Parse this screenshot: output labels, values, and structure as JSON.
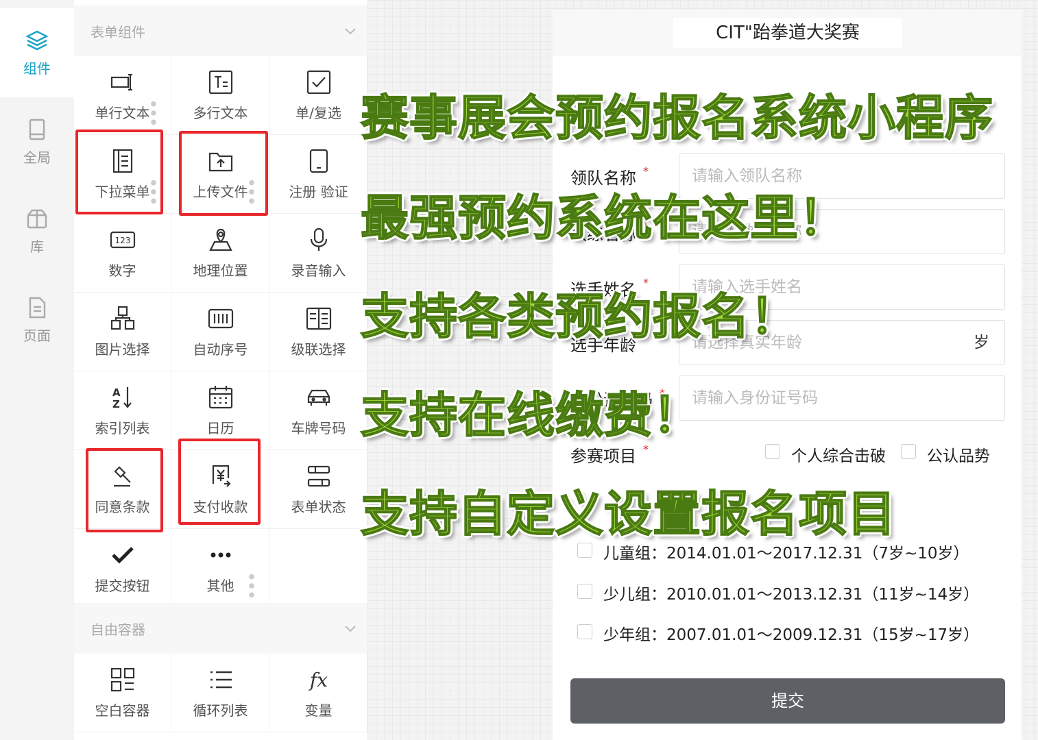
{
  "nav": [
    {
      "label": "组件",
      "icon": "layers-icon",
      "active": true
    },
    {
      "label": "全局",
      "icon": "tablet-icon"
    },
    {
      "label": "库",
      "icon": "box-icon"
    },
    {
      "label": "页面",
      "icon": "document-icon"
    }
  ],
  "sections": {
    "form_components": "表单组件",
    "free_containers": "自由容器"
  },
  "components": {
    "single_text": "单行文本",
    "multi_text": "多行文本",
    "checkbox": "单/复选",
    "dropdown": "下拉菜单",
    "upload": "上传文件",
    "register": "注册 验证",
    "number": "数字",
    "location": "地理位置",
    "audio": "录音输入",
    "image_select": "图片选择",
    "auto_number": "自动序号",
    "cascade": "级联选择",
    "index_list": "索引列表",
    "calendar": "日历",
    "plate": "车牌号码",
    "agree": "同意条款",
    "payment": "支付收款",
    "form_status": "表单状态",
    "submit_button": "提交按钮",
    "other": "其他"
  },
  "containers": {
    "blank": "空白容器",
    "loop_list": "循环列表",
    "variable": "变量"
  },
  "preview": {
    "title": "CIT\"跆拳道大奖赛",
    "fields": [
      {
        "label": "领队名称",
        "placeholder": "请输入领队名称"
      },
      {
        "label": "教练名称",
        "placeholder": "请输入教练名称"
      },
      {
        "label": "选手姓名",
        "placeholder": "请输入选手姓名"
      },
      {
        "label": "选手年龄",
        "placeholder": "请选择真实年龄",
        "suffix": "岁"
      },
      {
        "label": "身份证号码",
        "placeholder": "请输入身份证号码"
      }
    ],
    "required_mark": "*",
    "event_label": "参赛项目",
    "event_options": [
      "个人综合击破",
      "公认品势"
    ],
    "groups": [
      "儿童组：2014.01.01～2017.12.31（7岁~10岁）",
      "少儿组：2010.01.01～2013.12.31（11岁~14岁）",
      "少年组：2007.01.01～2009.12.31（15岁~17岁）"
    ],
    "submit": "提交"
  },
  "promo": [
    "赛事展会预约报名系统小程序",
    "最强预约系统在这里！",
    "支持各类预约报名！",
    "支持在线缴费！",
    "支持自定义设置报名项目"
  ],
  "colors": {
    "accent": "#1aa3c7",
    "highlight_box": "#e8262b",
    "promo_text": "#a5d83a",
    "submit_bg": "#5d6166"
  }
}
